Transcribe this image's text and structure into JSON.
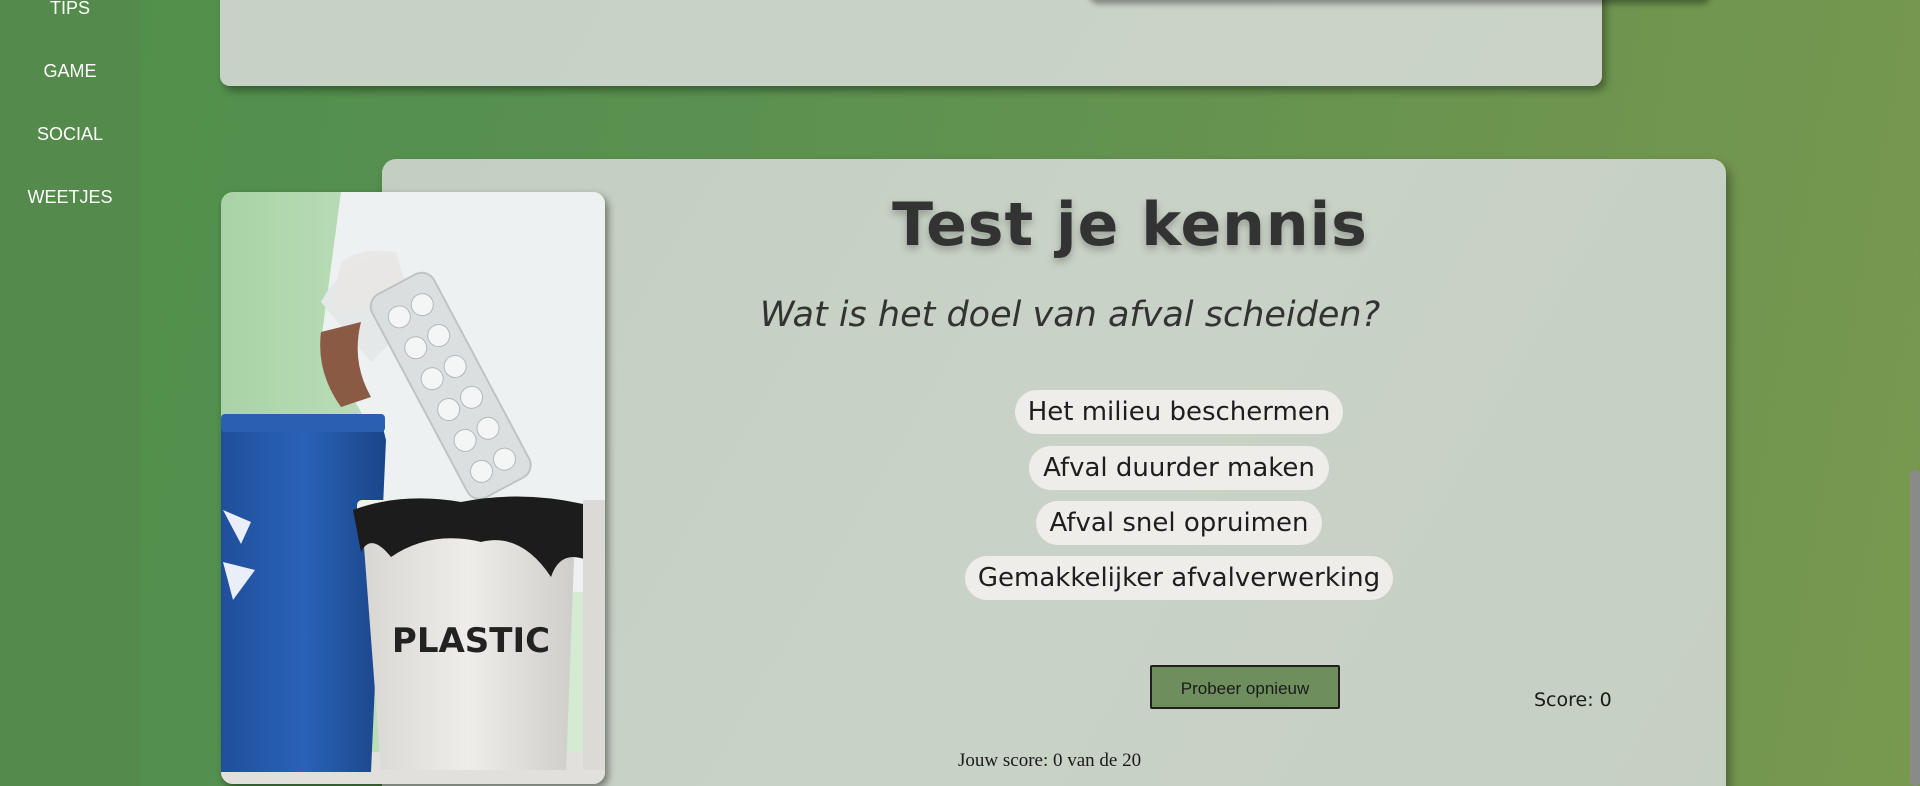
{
  "sidebar": {
    "items": [
      {
        "label": "TIPS"
      },
      {
        "label": "GAME"
      },
      {
        "label": "SOCIAL"
      },
      {
        "label": "WEETJES"
      }
    ]
  },
  "quiz": {
    "title": "Test je kennis",
    "question": "Wat is het doel van afval scheiden?",
    "answers": [
      {
        "label": "Het milieu beschermen"
      },
      {
        "label": "Afval duurder maken"
      },
      {
        "label": "Afval snel opruimen"
      },
      {
        "label": "Gemakkelijker afvalverwerking"
      }
    ],
    "retry_label": "Probeer opnieuw",
    "score_label": "Score: 0",
    "final_score_label": "Jouw score: 0 van de 20"
  },
  "photo": {
    "bin_label": "PLASTIC"
  }
}
